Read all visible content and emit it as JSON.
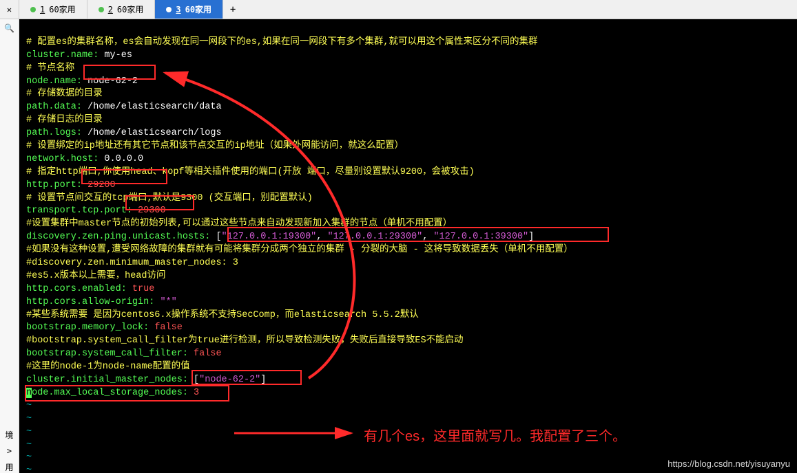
{
  "tabs": {
    "close": "✕",
    "list": [
      {
        "num": "1",
        "label": "60家用"
      },
      {
        "num": "2",
        "label": "60家用"
      },
      {
        "num": "3",
        "label": "60家用"
      }
    ],
    "new": "+"
  },
  "sidebar": {
    "search": "🔍",
    "env": "境",
    "arrow": ">",
    "you": "用"
  },
  "code": {
    "c1": "# 配置es的集群名称，es会自动发现在同一网段下的es,如果在同一网段下有多个集群,就可以用这个属性来区分不同的集群",
    "c2k": "cluster.name:",
    "c2v": " my-es",
    "c3": "# 节点名称",
    "c4k": "node.name:",
    "c4v": " node-62-2",
    "c5": "# 存储数据的目录",
    "c6k": "path.data:",
    "c6v": " /home/elasticsearch/data",
    "c7": "# 存储日志的目录",
    "c8k": "path.logs:",
    "c8v": " /home/elasticsearch/logs",
    "c9": "# 设置绑定的ip地址还有其它节点和该节点交互的ip地址（如果外网能访问，就这么配置）",
    "c10k": "network.host:",
    "c10v": " 0.0.0.0",
    "c11": "# 指定http端口,你使用head、kopf等相关插件使用的端口(开放 端口，尽量别设置默认9200，会被攻击)",
    "c12k": "http.port:",
    "c12v": " 29200",
    "c13": "# 设置节点间交互的tcp端口,默认是9300 (交互端口，别配置默认)",
    "c14k": "transport.tcp.port:",
    "c14v": " 29300",
    "c15": "#设置集群中master节点的初始列表,可以通过这些节点来自动发现新加入集群的节点（单机不用配置）",
    "c16k": "discovery.zen.ping.unicast.hosts:",
    "c16b1": " [",
    "c16a": "\"127.0.0.1:19300\"",
    "c16s1": ", ",
    "c16b": "\"127.0.0.1:29300\"",
    "c16s2": ", ",
    "c16c": "\"127.0.0.1:39300\"",
    "c16b2": "]",
    "c17": "#如果没有这种设置,遭受网络故障的集群就有可能将集群分成两个独立的集群 - 分裂的大脑 - 这将导致数据丢失（单机不用配置）",
    "c18": "#discovery.zen.minimum_master_nodes: 3",
    "c19": "#es5.x版本以上需要，head访问",
    "c20k": "http.cors.enabled:",
    "c20v": " true",
    "c21k": "http.cors.allow-origin:",
    "c21v": " \"*\"",
    "c22": "#某些系统需要 是因为centos6.x操作系统不支持SecComp，而elasticsearch 5.5.2默认",
    "c23k": "bootstrap.memory_lock:",
    "c23v": " false",
    "c24": "#bootstrap.system_call_filter为true进行检测，所以导致检测失败，失败后直接导致ES不能启动",
    "c25k": "bootstrap.system_call_filter:",
    "c25v": " false",
    "c26": "#这里的node-1为node-name配置的值",
    "c27k": "cluster.initial_master_nodes:",
    "c27b1": " [",
    "c27a": "\"node-62-2\"",
    "c27b2": "]",
    "c28k": "ode.max_local_storage_nodes:",
    "c28n": "n",
    "c28v": " 3",
    "tilde": "~"
  },
  "annotation": {
    "note": "有几个es，这里面就写几。我配置了三个。"
  },
  "watermark": "https://blog.csdn.net/yisuyanyu"
}
